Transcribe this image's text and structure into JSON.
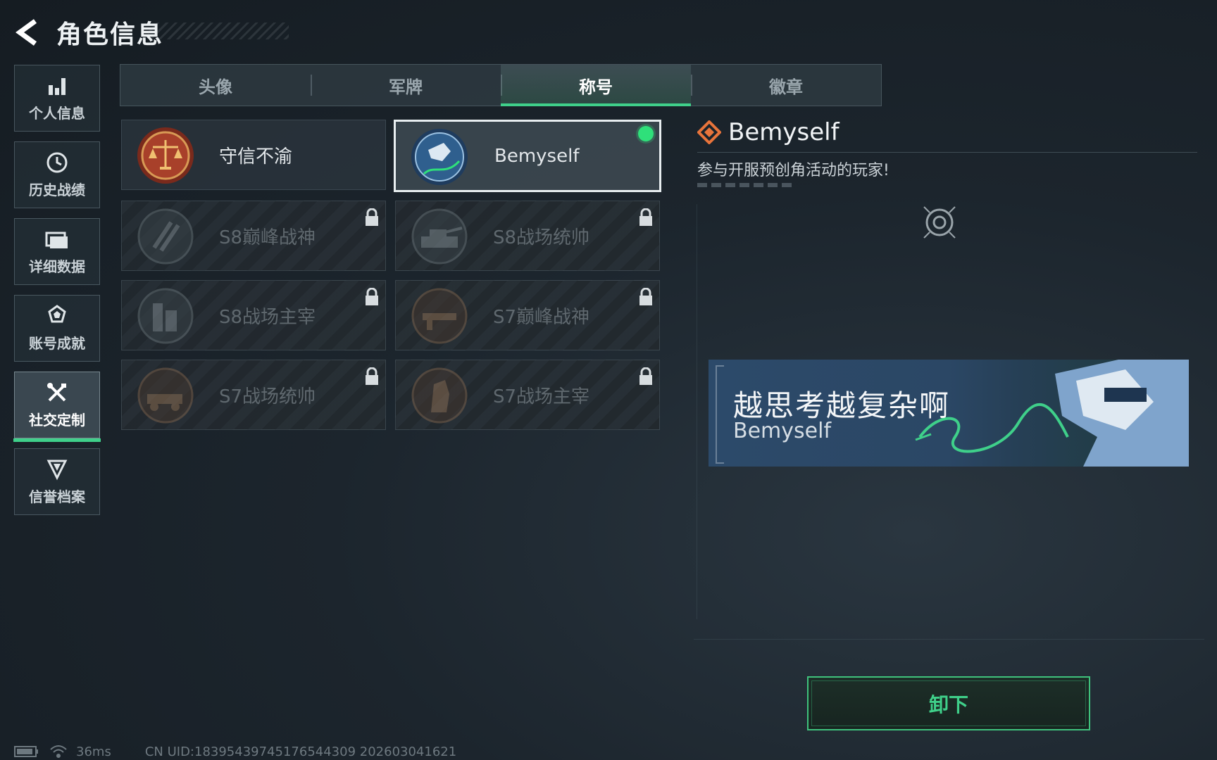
{
  "header": {
    "title": "角色信息"
  },
  "sidebar": {
    "items": [
      {
        "label": "个人信息",
        "icon": "bar-chart-icon"
      },
      {
        "label": "历史战绩",
        "icon": "history-clock-icon"
      },
      {
        "label": "详细数据",
        "icon": "folder-icon"
      },
      {
        "label": "账号成就",
        "icon": "achievement-icon"
      },
      {
        "label": "社交定制",
        "icon": "wrench-screwdriver-icon",
        "active": true
      },
      {
        "label": "信誉档案",
        "icon": "reputation-shield-icon"
      }
    ]
  },
  "tabs": [
    {
      "label": "头像"
    },
    {
      "label": "军牌"
    },
    {
      "label": "称号",
      "active": true
    },
    {
      "label": "徽章"
    }
  ],
  "titles": [
    {
      "label": "守信不渝",
      "locked": false
    },
    {
      "label": "Bemyself",
      "locked": false,
      "selected": true,
      "equipped": true
    },
    {
      "label": "S8巅峰战神",
      "locked": true
    },
    {
      "label": "S8战场统帅",
      "locked": true
    },
    {
      "label": "S8战场主宰",
      "locked": true
    },
    {
      "label": "S7巅峰战神",
      "locked": true
    },
    {
      "label": "S7战场统帅",
      "locked": true
    },
    {
      "label": "S7战场主宰",
      "locked": true
    }
  ],
  "detail": {
    "name": "Bemyself",
    "description": "参与开服预创角活动的玩家!",
    "banner_title": "越思考越复杂啊",
    "banner_subtitle": "Bemyself",
    "action_label": "卸下"
  },
  "footer": {
    "ping": "36ms",
    "uid": "CN UID:183954397451765443​09 202603041621"
  },
  "colors": {
    "accent": "#3fd08a",
    "detail_icon": "#e8743b"
  }
}
